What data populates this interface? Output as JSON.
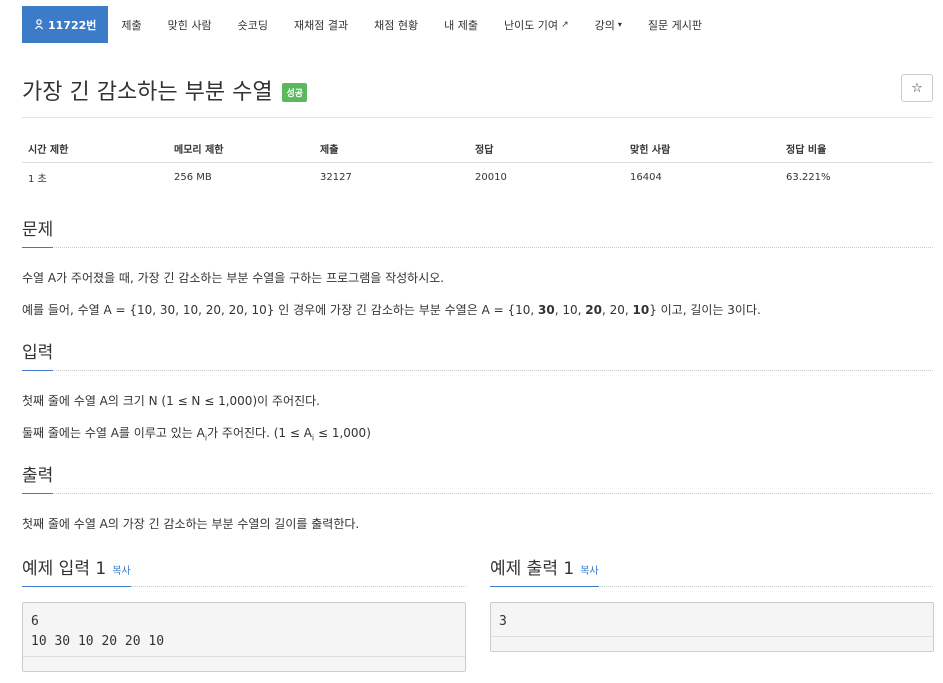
{
  "nav": {
    "problem_number": "11722번",
    "tabs": [
      {
        "label": "제출"
      },
      {
        "label": "맞힌 사람"
      },
      {
        "label": "숏코딩"
      },
      {
        "label": "재채점 결과"
      },
      {
        "label": "채점 현황"
      },
      {
        "label": "내 제출"
      },
      {
        "label": "난이도 기여"
      },
      {
        "label": "강의"
      },
      {
        "label": "질문 게시판"
      }
    ]
  },
  "problem": {
    "title": "가장 긴 감소하는 부분 수열",
    "badge": "성공",
    "star": "☆"
  },
  "info": {
    "headers": [
      "시간 제한",
      "메모리 제한",
      "제출",
      "정답",
      "맞힌 사람",
      "정답 비율"
    ],
    "values": [
      "1 초",
      "256 MB",
      "32127",
      "20010",
      "16404",
      "63.221%"
    ]
  },
  "sections": {
    "problem": {
      "heading": "문제",
      "line1": "수열 A가 주어졌을 때, 가장 긴 감소하는 부분 수열을 구하는 프로그램을 작성하시오.",
      "line2_a": "예를 들어, 수열 A = {10, 30, 10, 20, 20, 10} 인 경우에 가장 긴 감소하는 부분 수열은 A = {10, ",
      "line2_b1": "30",
      "line2_c": ", 10, ",
      "line2_b2": "20",
      "line2_d": ", 20, ",
      "line2_b3": "10",
      "line2_e": "}  이고, 길이는 3이다."
    },
    "input": {
      "heading": "입력",
      "line1": "첫째 줄에 수열 A의 크기 N (1 ≤ N ≤ 1,000)이 주어진다.",
      "line2_a": "둘째 줄에는 수열 A를 이루고 있는 A",
      "line2_sub": "i",
      "line2_b": "가 주어진다. (1 ≤ A",
      "line2_sub2": "i",
      "line2_c": " ≤ 1,000)"
    },
    "output": {
      "heading": "출력",
      "line1": "첫째 줄에 수열 A의 가장 긴 감소하는 부분 수열의 길이를 출력한다."
    },
    "sample_input": {
      "heading": "예제 입력 1",
      "copy": "복사",
      "content": "6\n10 30 10 20 20 10"
    },
    "sample_output": {
      "heading": "예제 출력 1",
      "copy": "복사",
      "content": "3"
    }
  }
}
